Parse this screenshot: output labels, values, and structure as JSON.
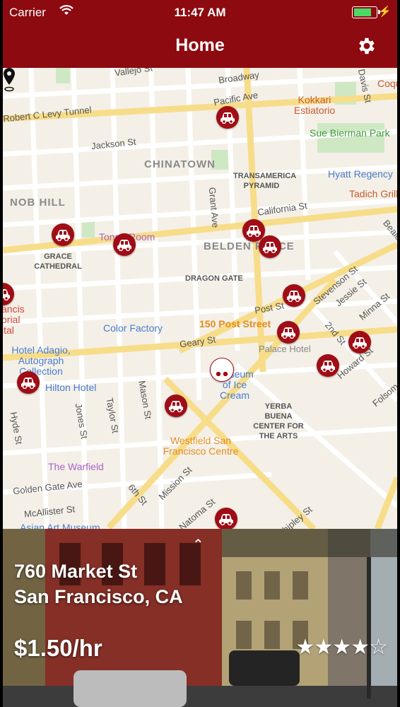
{
  "status_bar": {
    "carrier": "Carrier",
    "time": "11:47 AM",
    "battery_level": 0.85
  },
  "header": {
    "title": "Home",
    "settings_icon": "gear-icon"
  },
  "map": {
    "area_labels": [
      "CHINATOWN",
      "NOB HILL",
      "BELDEN PLACE"
    ],
    "streets": [
      "Vallejo St",
      "Broadway",
      "Pacific Ave",
      "Robert C Levy Tunnel",
      "Jackson St",
      "Davis St",
      "California St",
      "Grant Ave",
      "Post St",
      "Geary St",
      "Stevenson St",
      "Jessie St",
      "2nd St",
      "Minna St",
      "Howard St",
      "Folsom St",
      "Beale St",
      "Hyde St",
      "Jones St",
      "Taylor St",
      "Mason St",
      "6th St",
      "Mission St",
      "Natoma St",
      "Golden Gate Ave",
      "McAllister St",
      "Shipley St"
    ],
    "places": [
      "Kokkari Estiatorio",
      "Sue Bierman Park",
      "Hyatt Regency",
      "Tadich Grill",
      "TRANSAMERICA PYRAMID",
      "GRACE CATHEDRAL",
      "Tonga Room",
      "DRAGON GATE",
      "Color Factory",
      "150 Post Street",
      "Palace Hotel",
      "Hotel Adagio, Autograph Collection",
      "Hilton Hotel",
      "Museum of Ice Cream",
      "YERBA BUENA CENTER FOR THE ARTS",
      "Westfield San Francisco Centre",
      "The Warfield",
      "Asian Art Museum",
      "Coqu",
      "ancis orial ital"
    ],
    "parking_spots": 14
  },
  "detail": {
    "address_line1": "760 Market St",
    "address_line2": "San Francisco, CA",
    "price": "$1.50/hr",
    "rating": 4,
    "rating_max": 5,
    "expand_icon": "chevron-up-icon",
    "stars_text": "★★★★☆"
  }
}
